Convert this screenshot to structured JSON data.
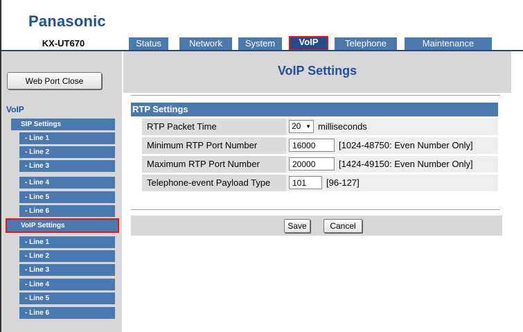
{
  "header": {
    "brand": "Panasonic",
    "model": "KX-UT670"
  },
  "tabs": [
    {
      "label": "Status",
      "active": false
    },
    {
      "label": "Network",
      "active": false
    },
    {
      "label": "System",
      "active": false
    },
    {
      "label": "VoIP",
      "active": true
    },
    {
      "label": "Telephone",
      "active": false
    },
    {
      "label": "Maintenance",
      "active": false
    }
  ],
  "sidebar": {
    "web_port_close": "Web Port Close",
    "heading": "VoIP",
    "sip_settings": "SIP Settings",
    "sip_lines": [
      "- Line 1",
      "- Line 2",
      "- Line 3",
      "- Line 4",
      "- Line 5",
      "- Line 6"
    ],
    "voip_settings": "VoIP Settings",
    "voip_lines": [
      "- Line 1",
      "- Line 2",
      "- Line 3",
      "- Line 4",
      "- Line 5",
      "- Line 6"
    ]
  },
  "main": {
    "title": "VoIP Settings",
    "section": "RTP Settings",
    "rows": {
      "packet_time": {
        "label": "RTP Packet Time",
        "value": "20",
        "unit": "milliseconds"
      },
      "min_port": {
        "label": "Minimum RTP Port Number",
        "value": "16000",
        "hint": "[1024-48750: Even Number Only]"
      },
      "max_port": {
        "label": "Maximum RTP Port Number",
        "value": "20000",
        "hint": "[1424-49150: Even Number Only]"
      },
      "payload": {
        "label": "Telephone-event Payload Type",
        "value": "101",
        "hint": "[96-127]"
      }
    },
    "save": "Save",
    "cancel": "Cancel"
  },
  "colors": {
    "accent_blue": "#4a79b0",
    "title_blue": "#1f4f9e",
    "highlight_red": "#e3161b"
  }
}
